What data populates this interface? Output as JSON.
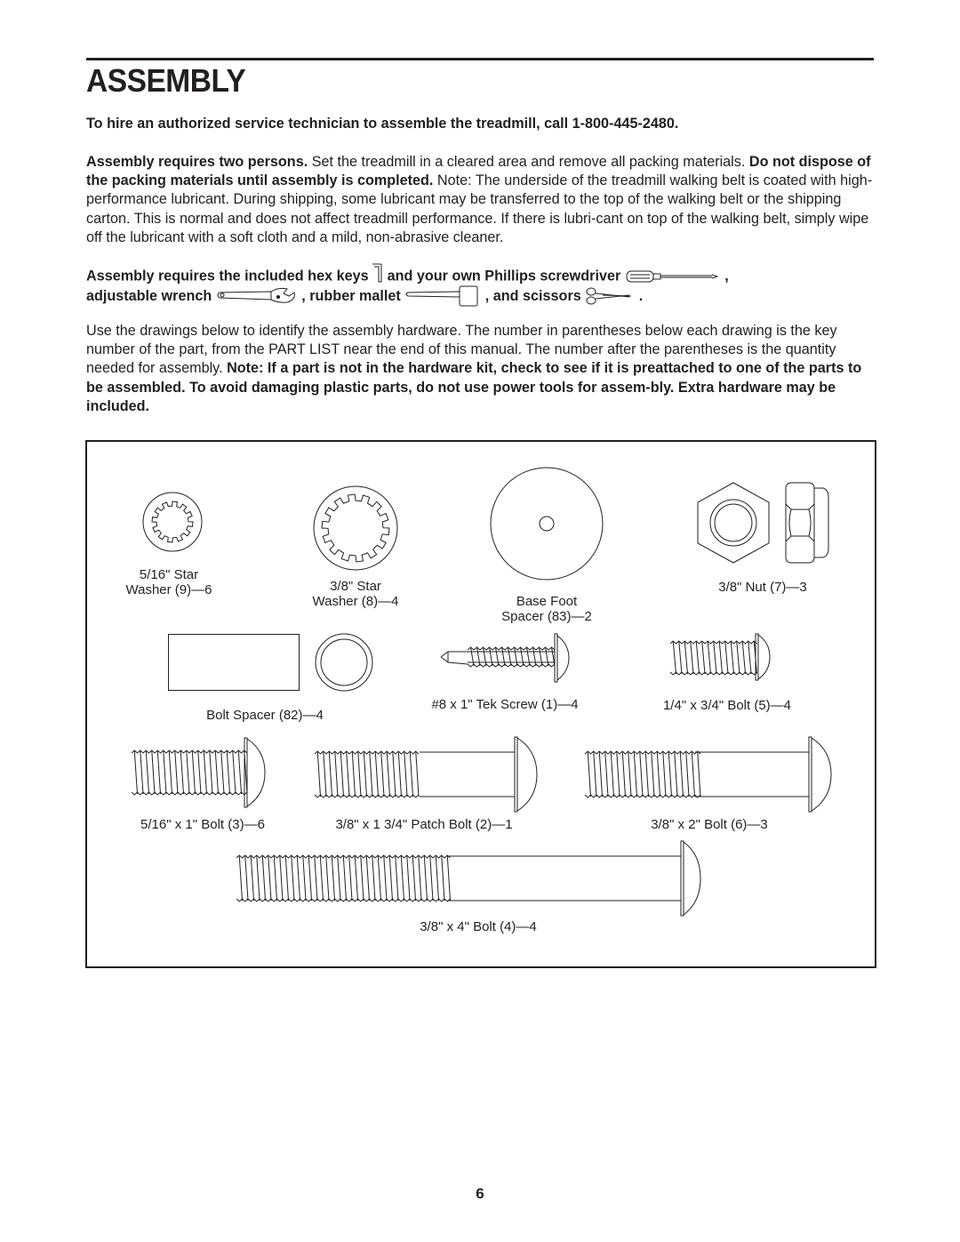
{
  "header": {
    "title": "ASSEMBLY"
  },
  "intro": {
    "service_line": "To hire an authorized service technician to assemble the treadmill, call 1-800-445-2480."
  },
  "paragraph1": {
    "bold1": "Assembly requires two persons.",
    "text1": " Set the treadmill in a cleared area and remove all packing materials. ",
    "bold2": "Do not dispose of the packing materials until assembly is completed.",
    "text2": " Note: The underside of the treadmill walking belt is coated with high-performance lubricant. During shipping, some lubricant may be transferred to the top of the walking belt or the shipping carton. This is normal and does not affect treadmill performance. If there is lubri-cant on top of the walking belt, simply wipe off the lubricant with a soft cloth and a mild, non-abrasive cleaner."
  },
  "tools": {
    "part1": "Assembly requires the included hex keys",
    "part2": "and your own Phillips screwdriver",
    "part3": ",",
    "part4": "adjustable wrench",
    "part5": ", rubber mallet",
    "part6": ", and scissors",
    "part7": ".",
    "icons": [
      "hex-key-icon",
      "screwdriver-icon",
      "wrench-icon",
      "mallet-icon",
      "scissors-icon"
    ]
  },
  "paragraph2": {
    "text1": "Use the drawings below to identify the assembly hardware. The number in parentheses below each drawing is the key number of the part, from the PART LIST near the end of this manual. The number after the parentheses is the quantity needed for assembly. ",
    "bold1": "Note: If a part is not in the hardware kit, check to see if it is preattached to one of the parts to be assembled. To avoid damaging plastic parts, do not use power tools for assem-bly. Extra hardware may be included."
  },
  "hardware": [
    {
      "name": "5/16\" Star Washer",
      "line1": "5/16\" Star",
      "line2": "Washer (9)—6",
      "key": 9,
      "qty": 6
    },
    {
      "name": "3/8\" Star Washer",
      "line1": "3/8\" Star",
      "line2": "Washer (8)—4",
      "key": 8,
      "qty": 4
    },
    {
      "name": "Base Foot Spacer",
      "line1": "Base Foot",
      "line2": "Spacer (83)—2",
      "key": 83,
      "qty": 2
    },
    {
      "name": "3/8\" Nut",
      "line1": "3/8\" Nut (7)—3",
      "key": 7,
      "qty": 3
    },
    {
      "name": "Bolt Spacer",
      "line1": "Bolt Spacer (82)—4",
      "key": 82,
      "qty": 4
    },
    {
      "name": "#8 x 1\" Tek Screw",
      "line1": "#8 x 1\" Tek Screw (1)—4",
      "key": 1,
      "qty": 4
    },
    {
      "name": "1/4\" x 3/4\" Bolt",
      "line1": "1/4\" x 3/4\" Bolt (5)—4",
      "key": 5,
      "qty": 4
    },
    {
      "name": "5/16\" x 1\" Bolt",
      "line1": "5/16\" x 1\" Bolt (3)—6",
      "key": 3,
      "qty": 6
    },
    {
      "name": "3/8\" x 1 3/4\" Patch Bolt",
      "line1": "3/8\" x 1 3/4\" Patch Bolt (2)—1",
      "key": 2,
      "qty": 1
    },
    {
      "name": "3/8\" x 2\" Bolt",
      "line1": "3/8\" x 2\" Bolt (6)—3",
      "key": 6,
      "qty": 3
    },
    {
      "name": "3/8\" x 4\" Bolt",
      "line1": "3/8\" x 4\" Bolt (4)—4",
      "key": 4,
      "qty": 4
    }
  ],
  "footer": {
    "page_number": "6"
  }
}
